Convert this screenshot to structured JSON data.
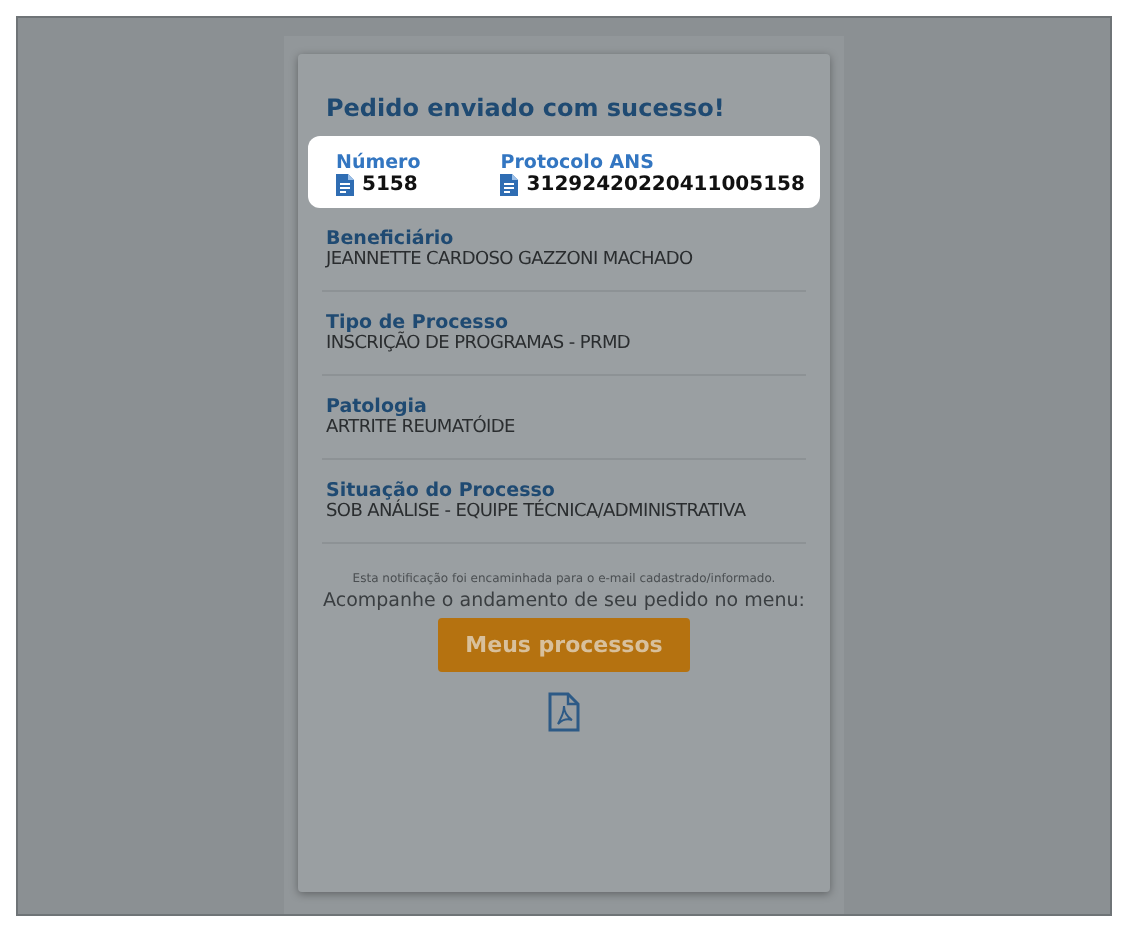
{
  "card": {
    "title": "Pedido enviado com sucesso!",
    "highlight_fields": [
      {
        "label": "Número",
        "value": "5158"
      },
      {
        "label": "Protocolo ANS",
        "value": "31292420220411005158"
      }
    ],
    "sections": [
      {
        "label": "Beneficiário",
        "value": "JEANNETTE CARDOSO GAZZONI MACHADO"
      },
      {
        "label": "Tipo de Processo",
        "value": "INSCRIÇÃO DE PROGRAMAS - PRMD"
      },
      {
        "label": "Patologia",
        "value": "ARTRITE REUMATÓIDE"
      },
      {
        "label": "Situação do Processo",
        "value": "SOB ANÁLISE - EQUIPE TÉCNICA/ADMINISTRATIVA"
      }
    ],
    "notice": "Esta notificação foi encaminhada para o e-mail cadastrado/informado.",
    "prompt": "Acompanhe o andamento de seu pedido no menu:",
    "button": "Meus processos"
  }
}
